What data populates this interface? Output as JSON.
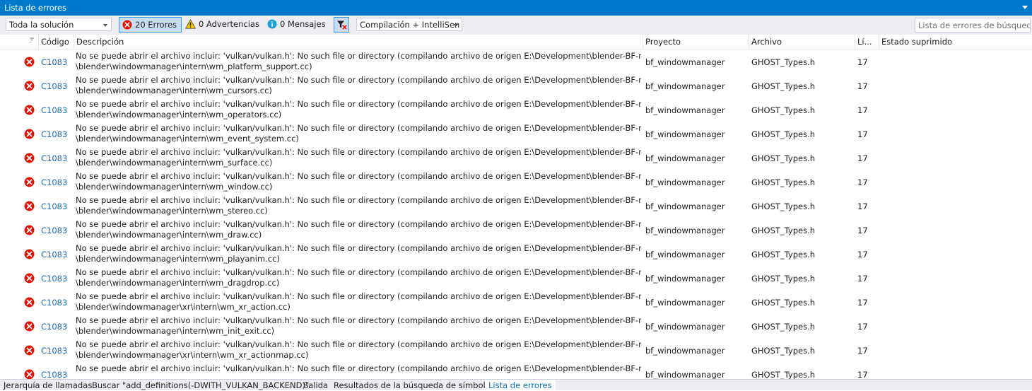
{
  "window": {
    "title": "Lista de errores"
  },
  "toolbar": {
    "scope": "Toda la solución",
    "errors": "20 Errores",
    "warnings": "0 Advertencias",
    "messages": "0 Mensajes",
    "source": "Compilación + IntelliSen",
    "search_placeholder": "Lista de errores de búsqueda"
  },
  "columns": {
    "code": "Código",
    "description": "Descripción",
    "project": "Proyecto",
    "file": "Archivo",
    "line": "Lí...",
    "suppression": "Estado suprimido"
  },
  "rows": [
    {
      "code": "C1083",
      "desc1": "No se puede abrir el archivo incluir: 'vulkan/vulkan.h': No such file or directory (compilando archivo de origen E:\\Development\\blender-BF-new\\source",
      "desc2": "\\blender\\windowmanager\\intern\\wm_platform_support.cc)",
      "project": "bf_windowmanager",
      "file": "GHOST_Types.h",
      "line": "17"
    },
    {
      "code": "C1083",
      "desc1": "No se puede abrir el archivo incluir: 'vulkan/vulkan.h': No such file or directory (compilando archivo de origen E:\\Development\\blender-BF-new\\source",
      "desc2": "\\blender\\windowmanager\\intern\\wm_cursors.cc)",
      "project": "bf_windowmanager",
      "file": "GHOST_Types.h",
      "line": "17"
    },
    {
      "code": "C1083",
      "desc1": "No se puede abrir el archivo incluir: 'vulkan/vulkan.h': No such file or directory (compilando archivo de origen E:\\Development\\blender-BF-new\\source",
      "desc2": "\\blender\\windowmanager\\intern\\wm_operators.cc)",
      "project": "bf_windowmanager",
      "file": "GHOST_Types.h",
      "line": "17"
    },
    {
      "code": "C1083",
      "desc1": "No se puede abrir el archivo incluir: 'vulkan/vulkan.h': No such file or directory (compilando archivo de origen E:\\Development\\blender-BF-new\\source",
      "desc2": "\\blender\\windowmanager\\intern\\wm_event_system.cc)",
      "project": "bf_windowmanager",
      "file": "GHOST_Types.h",
      "line": "17"
    },
    {
      "code": "C1083",
      "desc1": "No se puede abrir el archivo incluir: 'vulkan/vulkan.h': No such file or directory (compilando archivo de origen E:\\Development\\blender-BF-new\\source",
      "desc2": "\\blender\\windowmanager\\intern\\wm_surface.cc)",
      "project": "bf_windowmanager",
      "file": "GHOST_Types.h",
      "line": "17"
    },
    {
      "code": "C1083",
      "desc1": "No se puede abrir el archivo incluir: 'vulkan/vulkan.h': No such file or directory (compilando archivo de origen E:\\Development\\blender-BF-new\\source",
      "desc2": "\\blender\\windowmanager\\intern\\wm_window.cc)",
      "project": "bf_windowmanager",
      "file": "GHOST_Types.h",
      "line": "17"
    },
    {
      "code": "C1083",
      "desc1": "No se puede abrir el archivo incluir: 'vulkan/vulkan.h': No such file or directory (compilando archivo de origen E:\\Development\\blender-BF-new\\source",
      "desc2": "\\blender\\windowmanager\\intern\\wm_stereo.cc)",
      "project": "bf_windowmanager",
      "file": "GHOST_Types.h",
      "line": "17"
    },
    {
      "code": "C1083",
      "desc1": "No se puede abrir el archivo incluir: 'vulkan/vulkan.h': No such file or directory (compilando archivo de origen E:\\Development\\blender-BF-new\\source",
      "desc2": "\\blender\\windowmanager\\intern\\wm_draw.cc)",
      "project": "bf_windowmanager",
      "file": "GHOST_Types.h",
      "line": "17"
    },
    {
      "code": "C1083",
      "desc1": "No se puede abrir el archivo incluir: 'vulkan/vulkan.h': No such file or directory (compilando archivo de origen E:\\Development\\blender-BF-new\\source",
      "desc2": "\\blender\\windowmanager\\intern\\wm_playanim.cc)",
      "project": "bf_windowmanager",
      "file": "GHOST_Types.h",
      "line": "17"
    },
    {
      "code": "C1083",
      "desc1": "No se puede abrir el archivo incluir: 'vulkan/vulkan.h': No such file or directory (compilando archivo de origen E:\\Development\\blender-BF-new\\source",
      "desc2": "\\blender\\windowmanager\\intern\\wm_dragdrop.cc)",
      "project": "bf_windowmanager",
      "file": "GHOST_Types.h",
      "line": "17"
    },
    {
      "code": "C1083",
      "desc1": "No se puede abrir el archivo incluir: 'vulkan/vulkan.h': No such file or directory (compilando archivo de origen E:\\Development\\blender-BF-new\\source",
      "desc2": "\\blender\\windowmanager\\xr\\intern\\wm_xr_action.cc)",
      "project": "bf_windowmanager",
      "file": "GHOST_Types.h",
      "line": "17"
    },
    {
      "code": "C1083",
      "desc1": "No se puede abrir el archivo incluir: 'vulkan/vulkan.h': No such file or directory (compilando archivo de origen E:\\Development\\blender-BF-new\\source",
      "desc2": "\\blender\\windowmanager\\intern\\wm_init_exit.cc)",
      "project": "bf_windowmanager",
      "file": "GHOST_Types.h",
      "line": "17"
    },
    {
      "code": "C1083",
      "desc1": "No se puede abrir el archivo incluir: 'vulkan/vulkan.h': No such file or directory (compilando archivo de origen E:\\Development\\blender-BF-new\\source",
      "desc2": "\\blender\\windowmanager\\xr\\intern\\wm_xr_actionmap.cc)",
      "project": "bf_windowmanager",
      "file": "GHOST_Types.h",
      "line": "17"
    },
    {
      "code": "C1083",
      "desc1": "No se puede abrir el archivo incluir: 'vulkan/vulkan.h': No such file or directory (compilando archivo de origen E:\\Development\\blender-BF-new\\source",
      "desc2": "",
      "project": "bf_windowmanager",
      "file": "GHOST_Types.h",
      "line": "17"
    }
  ],
  "bottom_tabs": [
    {
      "label": "Jerarquía de llamadas"
    },
    {
      "label": "Buscar \"add_definitions(-DWITH_VULKAN_BACKEND)\""
    },
    {
      "label": "Salida"
    },
    {
      "label": "Resultados de la búsqueda de símbolos"
    },
    {
      "label": "Lista de errores"
    }
  ],
  "colors": {
    "accent": "#007acc",
    "error": "#e51400",
    "link": "#1a6bc1"
  }
}
